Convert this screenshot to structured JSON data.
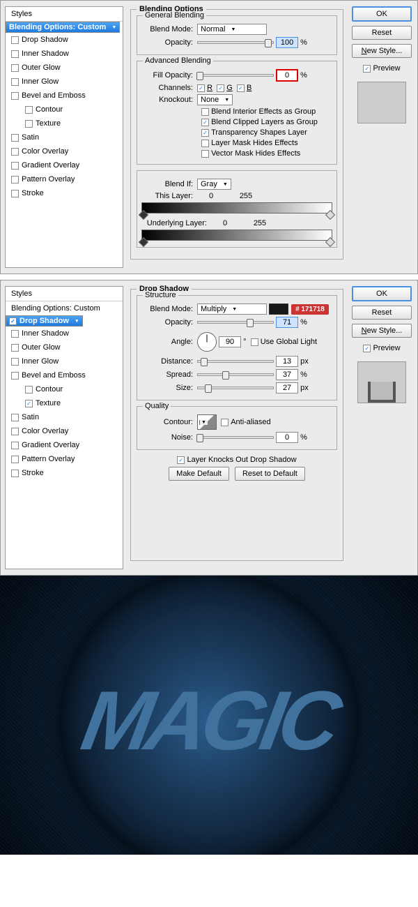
{
  "d1": {
    "sidebar_header": "Styles",
    "items": [
      {
        "label": "Blending Options: Custom",
        "sel": true,
        "ck": false,
        "cb": false
      },
      {
        "label": "Drop Shadow",
        "ck": false,
        "cb": true
      },
      {
        "label": "Inner Shadow",
        "ck": false,
        "cb": true
      },
      {
        "label": "Outer Glow",
        "ck": false,
        "cb": true
      },
      {
        "label": "Inner Glow",
        "ck": false,
        "cb": true
      },
      {
        "label": "Bevel and Emboss",
        "ck": false,
        "cb": true
      },
      {
        "label": "Contour",
        "ck": false,
        "cb": true,
        "sub": true
      },
      {
        "label": "Texture",
        "ck": false,
        "cb": true,
        "sub": true
      },
      {
        "label": "Satin",
        "ck": false,
        "cb": true
      },
      {
        "label": "Color Overlay",
        "ck": false,
        "cb": true
      },
      {
        "label": "Gradient Overlay",
        "ck": false,
        "cb": true
      },
      {
        "label": "Pattern Overlay",
        "ck": false,
        "cb": true
      },
      {
        "label": "Stroke",
        "ck": false,
        "cb": true
      }
    ],
    "title": "Blending Options",
    "gen": {
      "legend": "General Blending",
      "mode_l": "Blend Mode:",
      "mode": "Normal",
      "op_l": "Opacity:",
      "op": "100"
    },
    "adv": {
      "legend": "Advanced Blending",
      "fill_l": "Fill Opacity:",
      "fill": "0",
      "ch_l": "Channels:",
      "chR": "R",
      "chG": "G",
      "chB": "B",
      "ko_l": "Knockout:",
      "ko": "None",
      "o1": "Blend Interior Effects as Group",
      "o2": "Blend Clipped Layers as Group",
      "o3": "Transparency Shapes Layer",
      "o4": "Layer Mask Hides Effects",
      "o5": "Vector Mask Hides Effects"
    },
    "bi": {
      "l": "Blend If:",
      "v": "Gray",
      "tl": "This Layer:",
      "ul": "Underlying Layer:",
      "a": "0",
      "b": "255"
    },
    "btn": {
      "ok": "OK",
      "reset": "Reset",
      "new": "New Style...",
      "prev": "Preview"
    }
  },
  "d2": {
    "sidebar_header": "Styles",
    "items": [
      {
        "label": "Blending Options: Custom",
        "cb": false
      },
      {
        "label": "Drop Shadow",
        "sel": true,
        "ck": true,
        "cb": true
      },
      {
        "label": "Inner Shadow",
        "ck": false,
        "cb": true
      },
      {
        "label": "Outer Glow",
        "ck": false,
        "cb": true
      },
      {
        "label": "Inner Glow",
        "ck": false,
        "cb": true
      },
      {
        "label": "Bevel and Emboss",
        "ck": false,
        "cb": true
      },
      {
        "label": "Contour",
        "ck": false,
        "cb": true,
        "sub": true
      },
      {
        "label": "Texture",
        "ck": true,
        "cb": true,
        "sub": true
      },
      {
        "label": "Satin",
        "ck": false,
        "cb": true
      },
      {
        "label": "Color Overlay",
        "ck": false,
        "cb": true
      },
      {
        "label": "Gradient Overlay",
        "ck": false,
        "cb": true
      },
      {
        "label": "Pattern Overlay",
        "ck": false,
        "cb": true
      },
      {
        "label": "Stroke",
        "ck": false,
        "cb": true
      }
    ],
    "title": "Drop Shadow",
    "st": {
      "legend": "Structure",
      "mode_l": "Blend Mode:",
      "mode": "Multiply",
      "color": "#171718",
      "ann": "# 171718",
      "op_l": "Opacity:",
      "op": "71",
      "ang_l": "Angle:",
      "ang": "90",
      "deg": "°",
      "ugl": "Use Global Light",
      "dist_l": "Distance:",
      "dist": "13",
      "spr_l": "Spread:",
      "spr": "37",
      "sz_l": "Size:",
      "sz": "27",
      "px": "px",
      "pct": "%"
    },
    "q": {
      "legend": "Quality",
      "cont_l": "Contour:",
      "aa": "Anti-aliased",
      "noise_l": "Noise:",
      "noise": "0"
    },
    "ft": {
      "ko": "Layer Knocks Out Drop Shadow",
      "md": "Make Default",
      "rd": "Reset to Default"
    },
    "btn": {
      "ok": "OK",
      "reset": "Reset",
      "new": "New Style...",
      "prev": "Preview"
    }
  },
  "hero": "MAGIC"
}
